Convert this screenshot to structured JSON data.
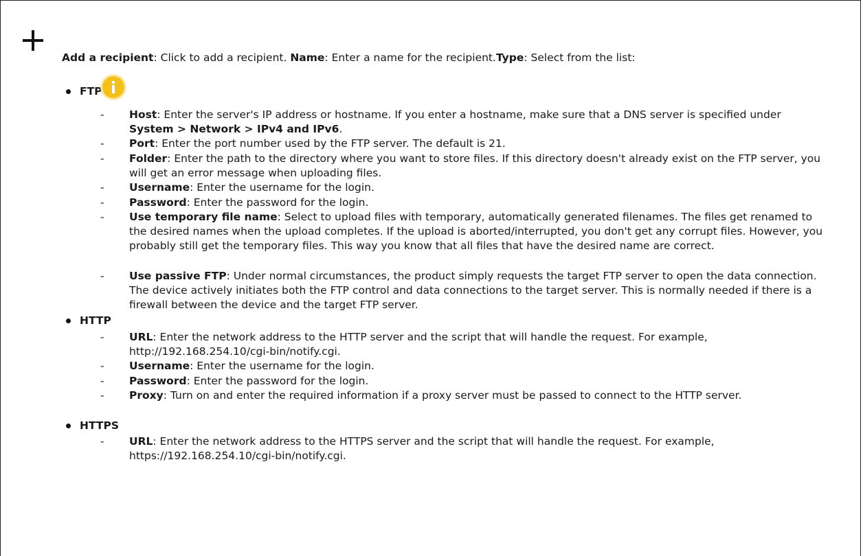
{
  "intro": {
    "add_label": "Add a recipient",
    "add_text": ": Click to add a recipient. ",
    "name_label": "Name",
    "name_text": ": Enter a name for the recipient.",
    "type_label": "Type",
    "type_text": ": Select from the list:"
  },
  "ftp": {
    "label": "FTP",
    "host": {
      "label": "Host",
      "text": ": Enter the server's IP address or hostname. If you enter a hostname, make sure that a DNS server is specified under ",
      "path": "System > Network > IPv4 and IPv6",
      "end": "."
    },
    "port": {
      "label": "Port",
      "text": ": Enter the port number used by the FTP server. The default is 21."
    },
    "folder": {
      "label": "Folder",
      "text": ": Enter the path to the directory where you want to store files. If this directory doesn't already exist on the FTP server, you will get an error message when uploading files."
    },
    "username": {
      "label": "Username",
      "text": ": Enter the username for the login."
    },
    "password": {
      "label": "Password",
      "text": ": Enter the password for the login."
    },
    "temp": {
      "label": "Use temporary file name",
      "text": ": Select to upload files with temporary, automatically generated filenames. The files get renamed to the desired names when the upload completes. If the upload is aborted/interrupted, you don't get any corrupt files. However, you probably still get the temporary files. This way you know that all files that have the desired name are correct."
    },
    "passive": {
      "label": "Use passive FTP",
      "text": ": Under normal circumstances, the product simply requests the target FTP server to open the data connection. The device actively initiates both the FTP control and data connections to the target server. This is normally needed if there is a firewall between the device and the target FTP server."
    }
  },
  "http": {
    "label": "HTTP",
    "url": {
      "label": "URL",
      "text": ": Enter the network address to the HTTP server and the script that will handle the request. For example, http://192.168.254.10/cgi-bin/notify.cgi."
    },
    "username": {
      "label": "Username",
      "text": ": Enter the username for the login."
    },
    "password": {
      "label": "Password",
      "text": ": Enter the password for the login."
    },
    "proxy": {
      "label": "Proxy",
      "text": ": Turn on and enter the required information if a proxy server must be passed to connect to the HTTP server."
    }
  },
  "https": {
    "label": "HTTPS",
    "url": {
      "label": "URL",
      "text": ": Enter the network address to the HTTPS server and the script that will handle the request. For example, https://192.168.254.10/cgi-bin/notify.cgi."
    }
  },
  "dash": "-"
}
